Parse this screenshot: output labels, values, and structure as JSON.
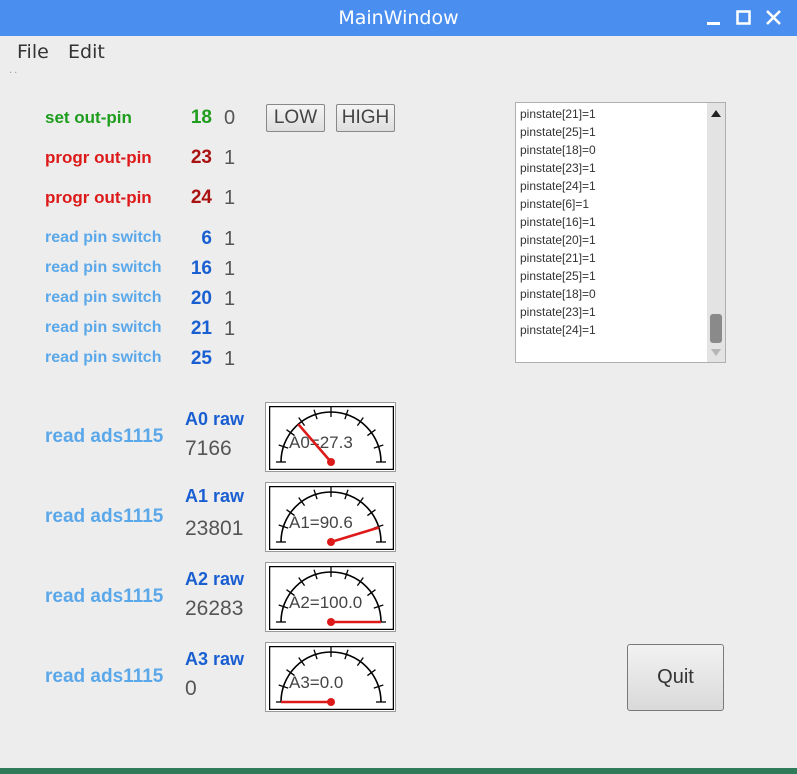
{
  "window": {
    "title": "MainWindow"
  },
  "menu": {
    "file": "File",
    "edit": "Edit"
  },
  "outputs": [
    {
      "label": "set out-pin",
      "pin": "18",
      "value": "0",
      "color": "#1e9d1e"
    },
    {
      "label": "progr out-pin",
      "pin": "23",
      "value": "1",
      "color": "#dd1a1a"
    },
    {
      "label": "progr out-pin",
      "pin": "24",
      "value": "1",
      "color": "#dd1a1a"
    }
  ],
  "buttons": {
    "low": "LOW",
    "high": "HIGH",
    "quit": "Quit"
  },
  "switches": [
    {
      "label": "read pin switch",
      "pin": "6",
      "value": "1"
    },
    {
      "label": "read pin switch",
      "pin": "16",
      "value": "1"
    },
    {
      "label": "read pin switch",
      "pin": "20",
      "value": "1"
    },
    {
      "label": "read pin switch",
      "pin": "21",
      "value": "1"
    },
    {
      "label": "read pin switch",
      "pin": "25",
      "value": "1"
    }
  ],
  "log": [
    "pinstate[21]=1",
    "pinstate[25]=1",
    "pinstate[18]=0",
    "pinstate[23]=1",
    "pinstate[24]=1",
    "pinstate[6]=1",
    "pinstate[16]=1",
    "pinstate[20]=1",
    "pinstate[21]=1",
    "pinstate[25]=1",
    "pinstate[18]=0",
    "pinstate[23]=1",
    "pinstate[24]=1"
  ],
  "adc": [
    {
      "label": "read ads1115",
      "raw_label": "A0 raw",
      "raw": "7166",
      "gauge_text": "A0=27.3",
      "value": 27.3
    },
    {
      "label": "read ads1115",
      "raw_label": "A1 raw",
      "raw": "23801",
      "gauge_text": "A1=90.6",
      "value": 90.6
    },
    {
      "label": "read ads1115",
      "raw_label": "A2 raw",
      "raw": "26283",
      "gauge_text": "A2=100.0",
      "value": 100.0
    },
    {
      "label": "read ads1115",
      "raw_label": "A3 raw",
      "raw": "0",
      "gauge_text": "A3=0.0",
      "value": 0.0
    }
  ],
  "colors": {
    "titlebar": "#4a8ff0",
    "switch_label": "#5aa8ea",
    "pin_blue": "#1a5fd1",
    "needle": "#dd1a1a"
  },
  "icons": {
    "scroll_up": "triangle-up",
    "scroll_down": "triangle-down"
  }
}
